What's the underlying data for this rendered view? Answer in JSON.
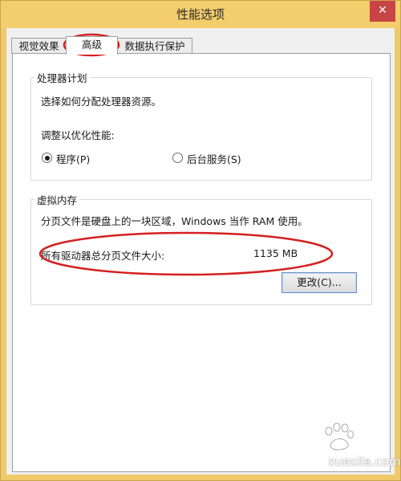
{
  "window": {
    "title": "性能选项",
    "close_glyph": "✕"
  },
  "tabs": [
    {
      "label": "视觉效果",
      "active": false
    },
    {
      "label": "高级",
      "active": true
    },
    {
      "label": "数据执行保护",
      "active": false
    }
  ],
  "processor_group": {
    "title": "处理器计划",
    "description": "选择如何分配处理器资源。",
    "optimize_label": "调整以优化性能:",
    "options": [
      {
        "label": "程序(P)",
        "checked": true
      },
      {
        "label": "后台服务(S)",
        "checked": false
      }
    ]
  },
  "virtual_memory_group": {
    "title": "虚拟内存",
    "description": "分页文件是硬盘上的一块区域，Windows 当作 RAM 使用。",
    "total_label": "所有驱动器总分页文件大小:",
    "total_value": "1135 MB",
    "change_button": "更改(C)..."
  },
  "annotation_color": "#d42020",
  "watermark": {
    "text": "xuexila.com",
    "logo_icon": "baidu-paw-icon"
  }
}
